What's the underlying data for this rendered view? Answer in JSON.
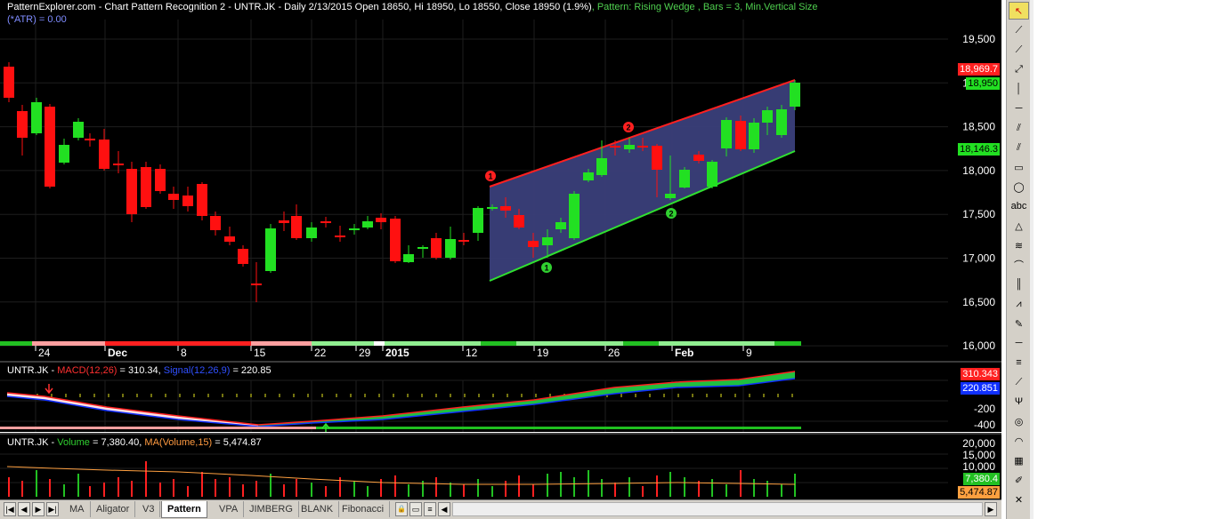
{
  "price_pane": {
    "title": "PatternExplorer.com - Chart Pattern Recognition 2 - UNTR.JK - Daily 2/13/2015 Open 18650, Hi 18950, Lo 18550, Close 18950 (1.9%)",
    "pattern_text": ", Pattern: Rising Wedge , Bars = 3, Min.Vertical Size",
    "subtitle": "(*ATR) = 0.00",
    "y_ticks": [
      "19,500",
      "19,000",
      "18,500",
      "18,000",
      "17,500",
      "17,000",
      "16,500",
      "16,000"
    ],
    "x_ticks": [
      "24",
      "Dec",
      "8",
      "15",
      "22",
      "29",
      "2015",
      "12",
      "19",
      "26",
      "Feb",
      "9"
    ],
    "tags": {
      "upper": "18,969.7",
      "close": "18,950",
      "lower": "18,146.3"
    },
    "markers": {
      "top1": "1",
      "top2": "2",
      "bot1": "1",
      "bot2": "2"
    },
    "colors": {
      "up": "#22e022",
      "down": "#ff1010",
      "wedge_fill": "#3a3f7a",
      "upper_line": "#ff2020",
      "lower_line": "#30e030"
    }
  },
  "macd_pane": {
    "symbol": "UNTR.JK - ",
    "macd_label": "MACD(12,26)",
    "macd_value": " = 310.34, ",
    "signal_label": "Signal(12,26,9)",
    "signal_value": " = 220.85",
    "y_ticks": [
      "-200",
      "-400"
    ],
    "tags": {
      "macd": "310.343",
      "signal": "220.851"
    }
  },
  "volume_pane": {
    "symbol": "UNTR.JK - ",
    "volume_label": "Volume",
    "volume_value": " = 7,380.40, ",
    "ma_label": "MA(Volume,15)",
    "ma_value": " = 5,474.87",
    "y_ticks": [
      "20,000",
      "15,000",
      "10,000"
    ],
    "tags": {
      "volume": "7,380.4",
      "ma": "5,474.87"
    }
  },
  "tabs": [
    "MA",
    "Aligator",
    "V3",
    "Pattern",
    "VPA",
    "JIMBERG",
    "BLANK",
    "Fibonacci"
  ],
  "active_tab": "Pattern",
  "nav": {
    "first": "|◀",
    "prev": "◀",
    "next": "▶",
    "last": "▶|"
  },
  "toolbar_tools": [
    "select-arrow",
    "trendline",
    "ray",
    "extended-line",
    "vertical-line",
    "horizontal-line",
    "parallel-lines",
    "channel",
    "rectangle",
    "ellipse",
    "text",
    "triangle",
    "fib-retracement",
    "arc",
    "fib-timezones",
    "zigzag",
    "pencil",
    "divider",
    "lines-h",
    "fib-fan",
    "pitchfork",
    "gann",
    "cycles",
    "grid",
    "pen",
    "delete"
  ],
  "toolbar_text_label": "abc"
}
